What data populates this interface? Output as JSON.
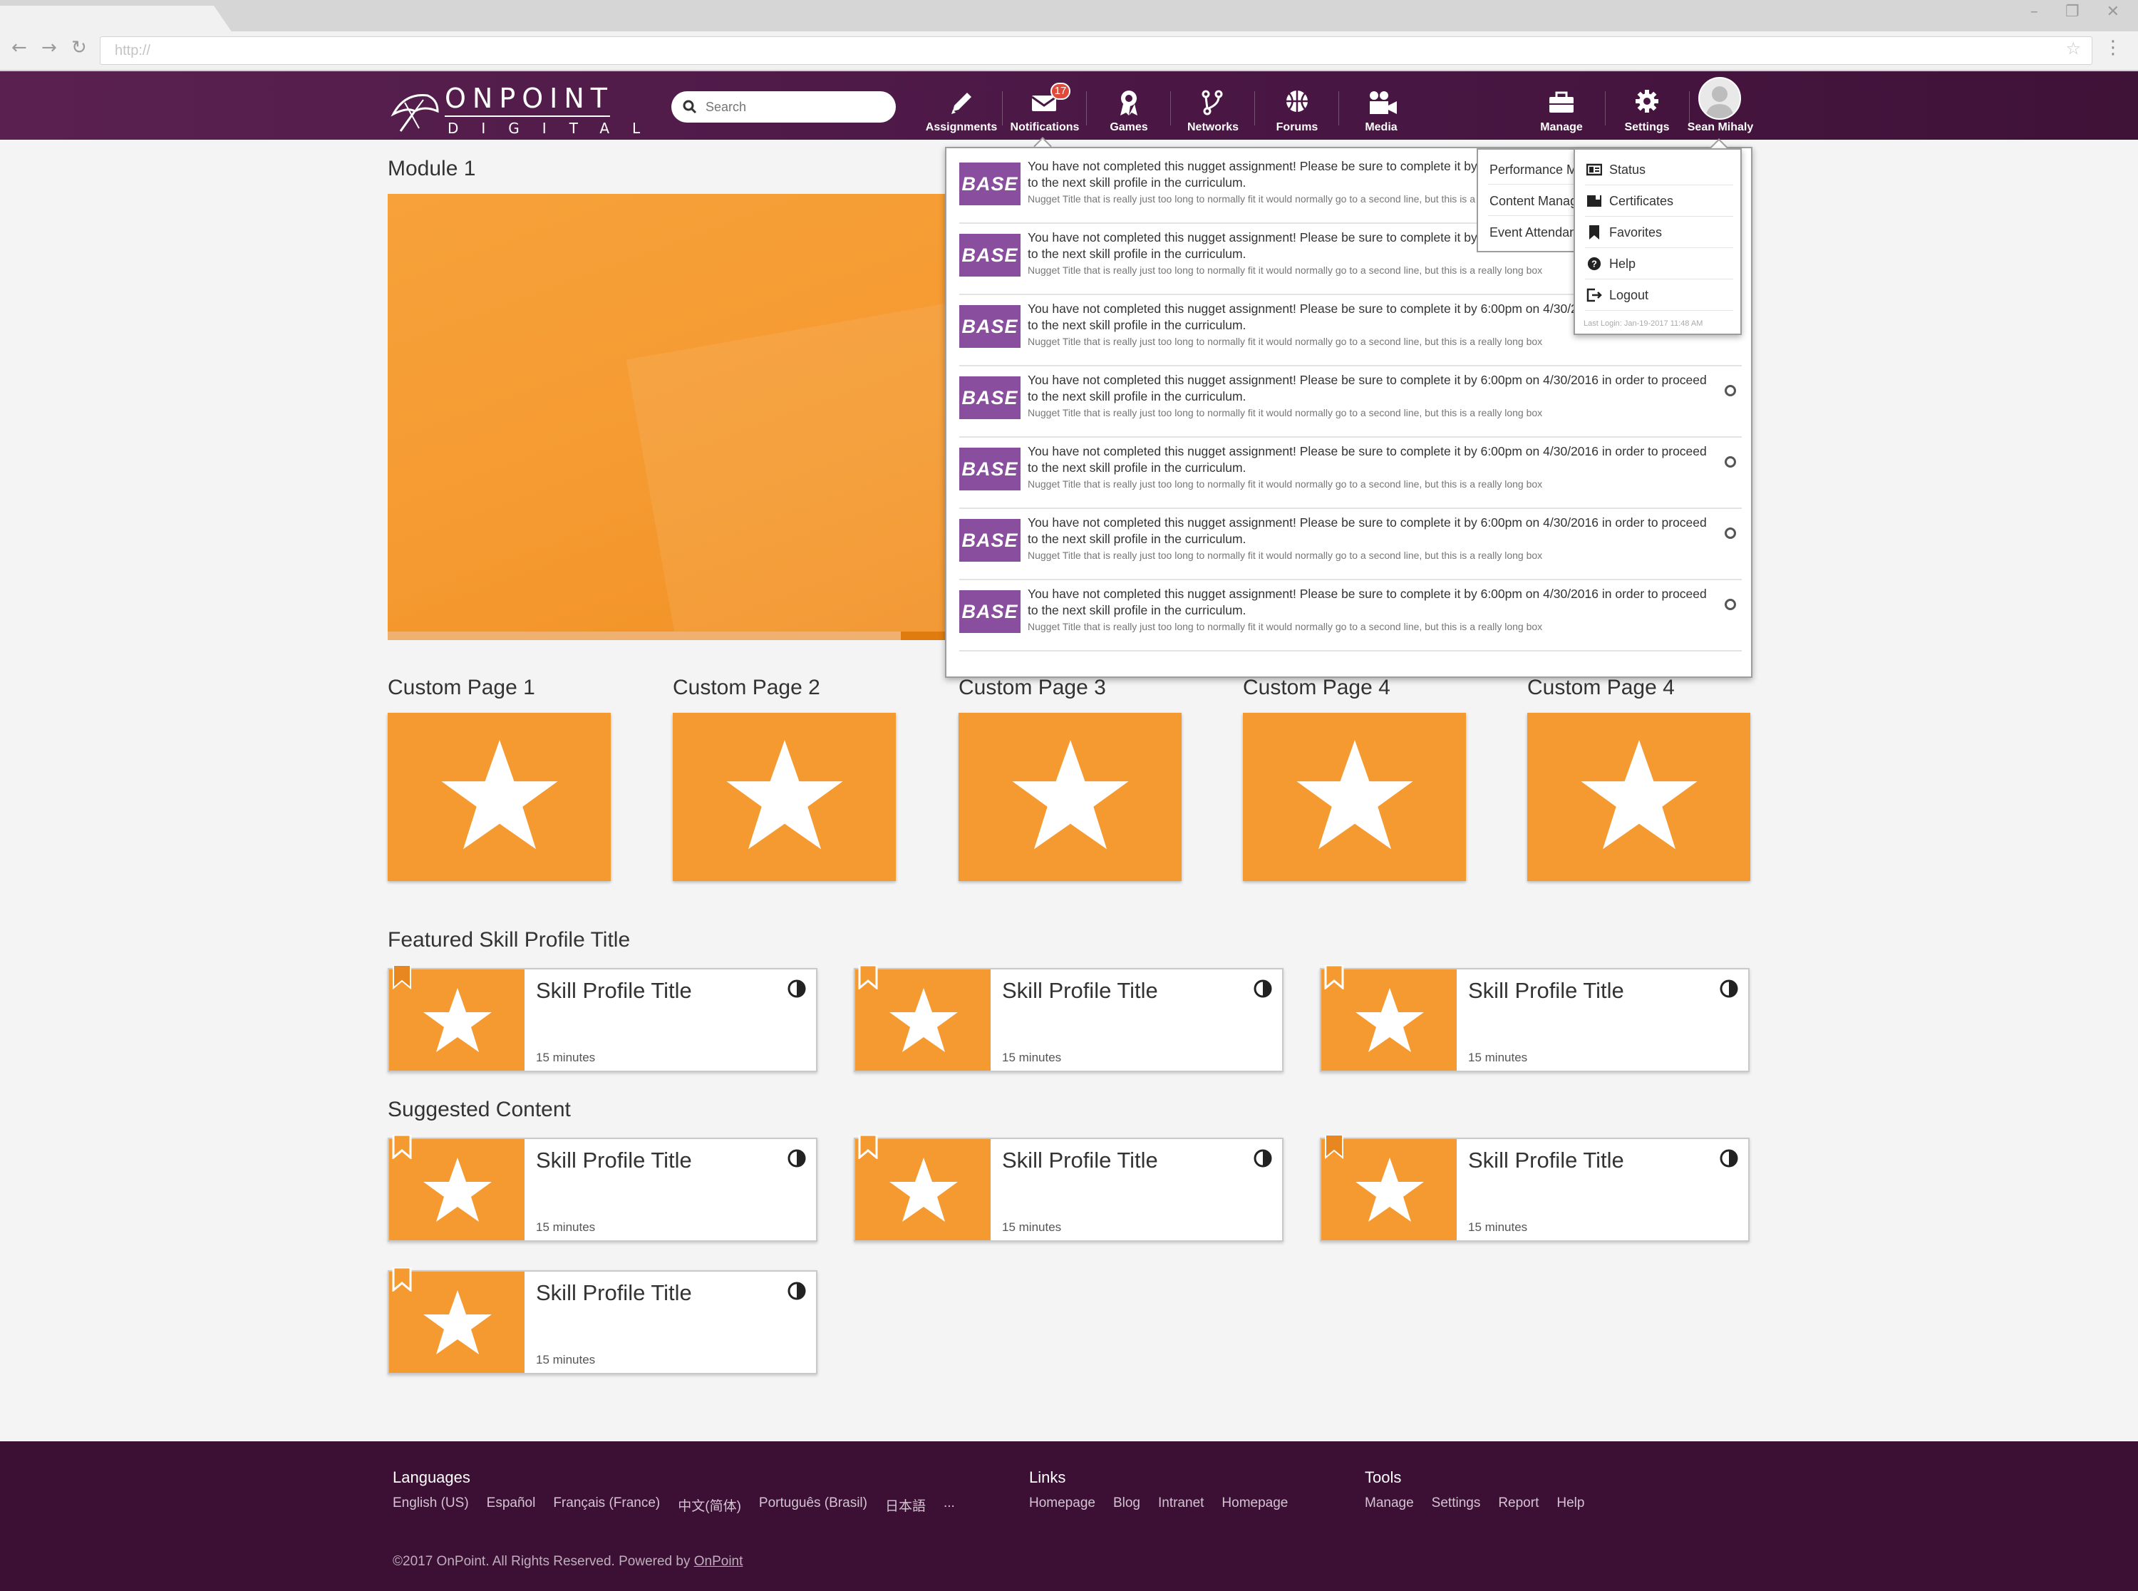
{
  "browser": {
    "url_placeholder": "http://"
  },
  "header": {
    "logo_top": "ONPOINT",
    "logo_bottom": "DIGITAL",
    "search_placeholder": "Search",
    "nav": {
      "assignments": "Assignments",
      "notifications": "Notifications",
      "notifications_count": "17",
      "games": "Games",
      "networks": "Networks",
      "forums": "Forums",
      "media": "Media",
      "manage": "Manage",
      "settings": "Settings",
      "user": "Sean Mihaly"
    }
  },
  "main": {
    "module_title": "Module 1",
    "hero_progress_fraction": 0.72,
    "custom_pages": [
      "Custom Page 1",
      "Custom Page 2",
      "Custom Page 3",
      "Custom Page 4",
      "Custom Page 4"
    ],
    "featured_title": "Featured Skill Profile Title",
    "suggested_title": "Suggested Content",
    "skill_title": "Skill Profile Title",
    "skill_duration": "15 minutes"
  },
  "notifications": {
    "items": [
      {
        "logo": "BASE",
        "message": "You have not completed this nugget assignment! Please be sure to complete it by 6:00pm on 4/30/2016 in order to proceed to the next skill profile in the curriculum.",
        "sub": "Nugget Title that is really just too long to normally fit it would normally go to a second line, but this is a really long box"
      },
      {
        "logo": "BASE",
        "message": "You have not completed this nugget assignment! Please be sure to complete it by 6:00pm on 4/30/2016 in order to proceed to the next skill profile in the curriculum.",
        "sub": "Nugget Title that is really just too long to normally fit it would normally go to a second line, but this is a really long box"
      },
      {
        "logo": "BASE",
        "message": "You have not completed this nugget assignment! Please be sure to complete it by 6:00pm on 4/30/2016 in order to proceed to the next skill profile in the curriculum.",
        "sub": "Nugget Title that is really just too long to normally fit it would normally go to a second line, but this is a really long box"
      },
      {
        "logo": "BASE",
        "message": "You have not completed this nugget assignment! Please be sure to complete it by 6:00pm on 4/30/2016 in order to proceed to the next skill profile in the curriculum.",
        "sub": "Nugget Title that is really just too long to normally fit it would normally go to a second line, but this is a really long box"
      },
      {
        "logo": "BASE",
        "message": "You have not completed this nugget assignment! Please be sure to complete it by 6:00pm on 4/30/2016 in order to proceed to the next skill profile in the curriculum.",
        "sub": "Nugget Title that is really just too long to normally fit it would normally go to a second line, but this is a really long box"
      },
      {
        "logo": "BASE",
        "message": "You have not completed this nugget assignment! Please be sure to complete it by 6:00pm on 4/30/2016 in order to proceed to the next skill profile in the curriculum.",
        "sub": "Nugget Title that is really just too long to normally fit it would normally go to a second line, but this is a really long box"
      },
      {
        "logo": "BASE",
        "message": "You have not completed this nugget assignment! Please be sure to complete it by 6:00pm on 4/30/2016 in order to proceed to the next skill profile in the curriculum.",
        "sub": "Nugget Title that is really just too long to normally fit it would normally go to a second line, but this is a really long box"
      }
    ]
  },
  "manage_menu": {
    "items": [
      "Performance Management",
      "Content Management",
      "Event Attendance"
    ]
  },
  "profile_menu": {
    "items": [
      "Status",
      "Certificates",
      "Favorites",
      "Help",
      "Logout"
    ],
    "last_login": "Last Login: Jan-19-2017 11:48 AM"
  },
  "footer": {
    "languages_heading": "Languages",
    "languages": [
      "English (US)",
      "Español",
      "Français (France)",
      "中文(简体)",
      "Português (Brasil)",
      "日本語",
      "..."
    ],
    "links_heading": "Links",
    "links": [
      "Homepage",
      "Blog",
      "Intranet",
      "Homepage"
    ],
    "tools_heading": "Tools",
    "tools": [
      "Manage",
      "Settings",
      "Report",
      "Help"
    ],
    "copyright": "©2017 OnPoint. All Rights Reserved. Powered by",
    "powered_by": "OnPoint"
  },
  "colors": {
    "brand_purple": "#4a1745",
    "accent_orange": "#f59a30",
    "base_purple": "#8a4e9f",
    "badge_red": "#e04a3a"
  }
}
